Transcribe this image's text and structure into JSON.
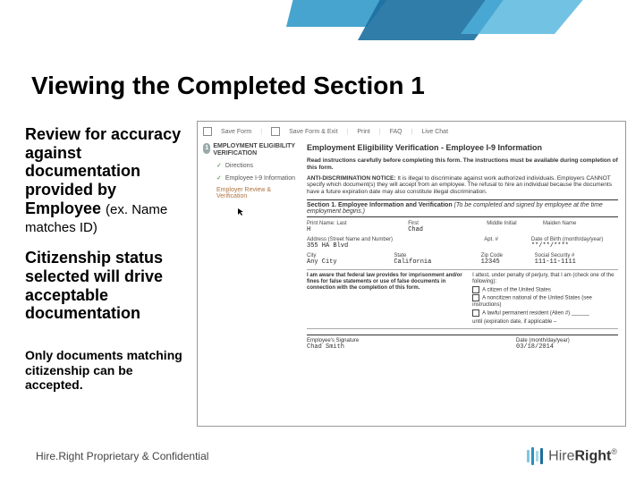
{
  "title": "Viewing the Completed Section 1",
  "left": {
    "p1a": "Review for accuracy against documentation provided by Employee ",
    "p1b": "(ex. Name matches ID)",
    "p2": "Citizenship status selected will drive acceptable documentation",
    "p3": "Only documents matching citizenship can be accepted."
  },
  "toolbar": {
    "save": "Save Form",
    "save_exit": "Save Form & Exit",
    "print": "Print",
    "faq": "FAQ",
    "chat": "Live Chat"
  },
  "nav": {
    "step_num": "1",
    "step_title": "EMPLOYMENT ELIGIBILITY VERIFICATION",
    "directions": "Directions",
    "emp_info": "Employee I-9 Information",
    "review": "Employer Review & Verification"
  },
  "form": {
    "heading": "Employment Eligibility Verification - Employee I-9 Information",
    "instr": "Read instructions carefully before completing this form. The instructions must be available during completion of this form.",
    "notice_label": "ANTI-DISCRIMINATION NOTICE:",
    "notice_text": " It is illegal to discriminate against work authorized individuals. Employers CANNOT specify which document(s) they will accept from an employee. The refusal to hire an individual because the documents have a future expiration date may also constitute illegal discrimination.",
    "section1": "Section 1. Employee Information and Verification",
    "section1_it": " (To be completed and signed by employee at the time employment begins.)",
    "row1": {
      "last_lbl": "Print Name: Last",
      "last_val": "H",
      "first_lbl": "First",
      "first_val": "Chad",
      "mi_lbl": "Middle Initial",
      "mi_val": "",
      "maiden_lbl": "Maiden Name",
      "maiden_val": ""
    },
    "row2": {
      "addr_lbl": "Address (Street Name and Number)",
      "addr_val": "355 HA Blvd",
      "apt_lbl": "Apt. #",
      "apt_val": "",
      "dob_lbl": "Date of Birth (month/day/year)",
      "dob_val": "**/**/****"
    },
    "row3": {
      "city_lbl": "City",
      "city_val": "Any City",
      "state_lbl": "State",
      "state_val": "California",
      "zip_lbl": "Zip Code",
      "zip_val": "12345",
      "ssn_lbl": "Social Security #",
      "ssn_val": "111-11-1111"
    },
    "aware": "I am aware that federal law provides for imprisonment and/or fines for false statements or use of false documents in connection with the completion of this form.",
    "attest_intro": "I attest, under penalty of perjury, that I am (check one of the following):",
    "opt1": "A citizen of the United States",
    "opt2": "A noncitizen national of the United States (see instructions)",
    "opt3": "A lawful permanent resident (Alien #) ",
    "opt3_line": "______",
    "opt4_line": "until (expiration date, if applicable – ",
    "sig_lbl": "Employee's Signature",
    "sig_val": "Chad Smith",
    "date_lbl": "Date (month/day/year)",
    "date_val": "03/18/2014"
  },
  "footer": {
    "confidential": "Hire.Right Proprietary & Confidential",
    "logo1": "Hire",
    "logo2": "Right"
  }
}
